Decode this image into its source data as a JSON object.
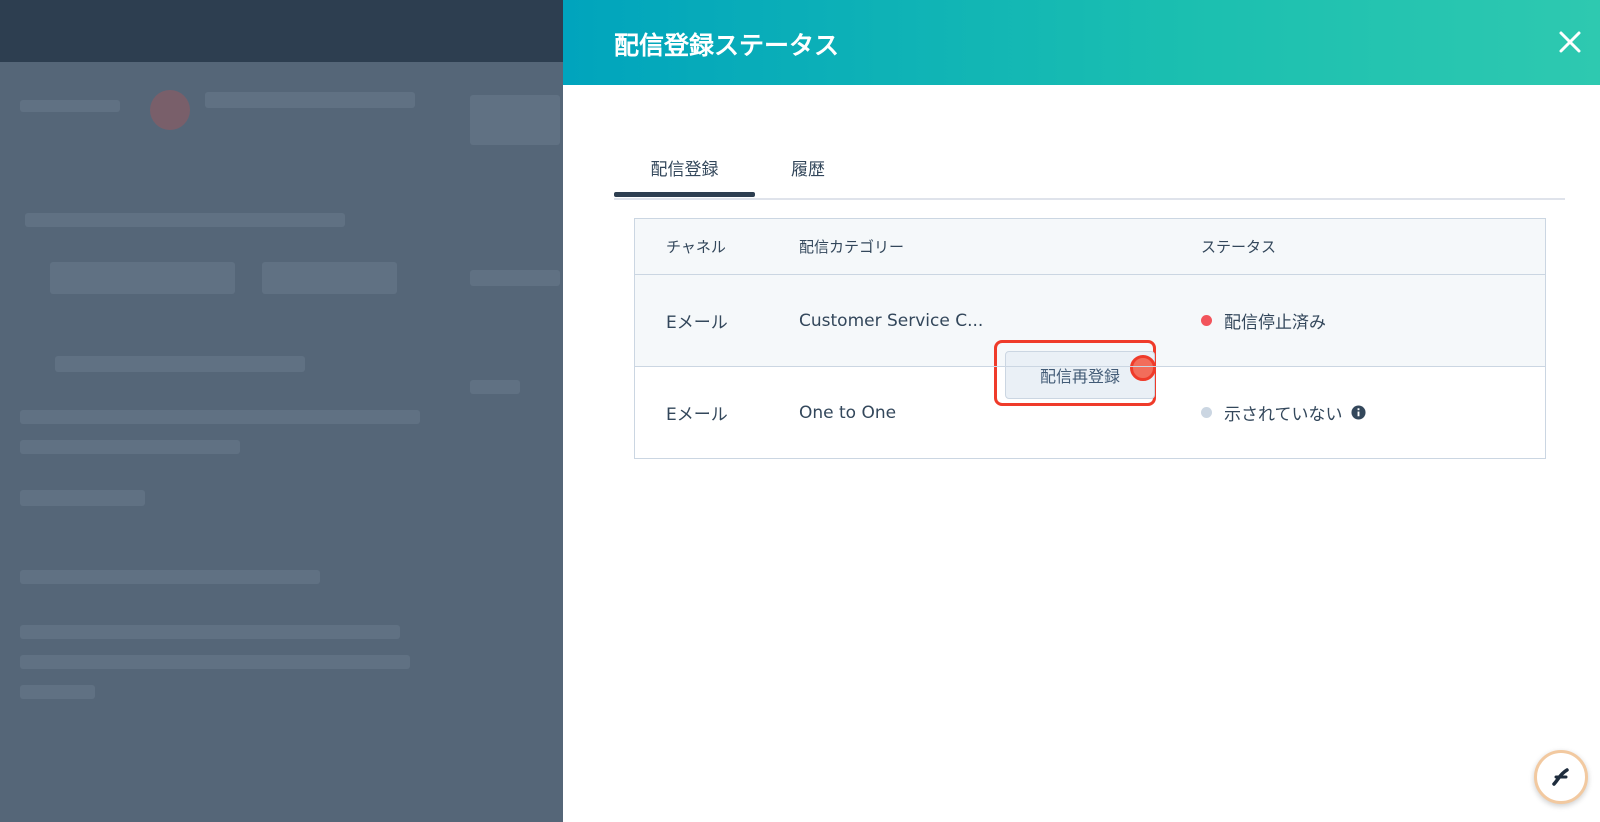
{
  "panel": {
    "title": "配信登録ステータス",
    "tabs": [
      {
        "label": "配信登録",
        "active": true
      },
      {
        "label": "履歴",
        "active": false
      }
    ]
  },
  "table": {
    "headers": {
      "channel": "チャネル",
      "category": "配信カテゴリー",
      "status": "ステータス"
    },
    "rows": [
      {
        "channel": "Eメール",
        "category": "Customer Service C...",
        "action": "配信再登録",
        "status": "配信停止済み",
        "status_color": "#f2545b"
      },
      {
        "channel": "Eメール",
        "category": "One to One",
        "status": "示されていない",
        "status_color": "#cbd6e2"
      }
    ]
  },
  "colors": {
    "header_start": "#00a4bd",
    "header_end": "#2ec9b0",
    "highlight": "#ef3b2a"
  },
  "icons": {
    "close": "close-icon",
    "info": "info-icon",
    "help": "chat-help-icon"
  }
}
